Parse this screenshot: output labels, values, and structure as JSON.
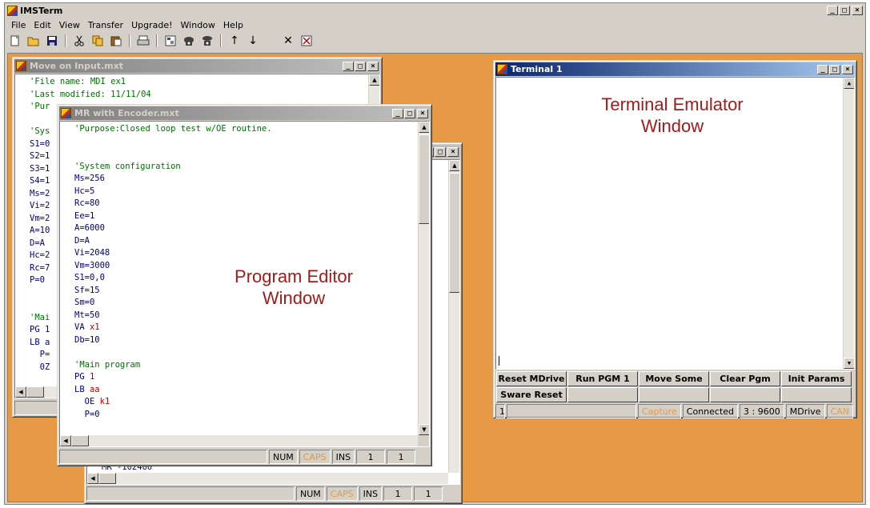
{
  "app": {
    "title": "IMSTerm"
  },
  "menu": [
    "File",
    "Edit",
    "View",
    "Transfer",
    "Upgrade!",
    "Window",
    "Help"
  ],
  "toolbar_icons": [
    "new-file-icon",
    "open-folder-icon",
    "save-icon",
    "cut-icon",
    "copy-icon",
    "paste-icon",
    "print-icon",
    "properties-icon",
    "connect-icon",
    "disconnect-icon",
    "upload-icon",
    "download-icon",
    "close-x-icon",
    "stop-box-icon"
  ],
  "windows": {
    "move_on_input": {
      "title": "Move on Input.mxt",
      "lines": [
        "'File name: MDI ex1",
        "'Last modified: 11/11/04",
        "'Pur",
        "",
        "'Sys",
        "S1=0",
        "S2=1",
        "S3=1",
        "S4=1",
        "Ms=2",
        "Vi=2",
        "Vm=2",
        "A=10",
        "D=A",
        "Hc=2",
        "Rc=7",
        "P=0",
        "",
        "",
        "'Mai",
        "PG 1",
        "LB a",
        "  P=",
        "  0Z"
      ]
    },
    "third_editor": {
      "lines": [
        "MR -102400"
      ],
      "status": {
        "num": "NUM",
        "caps": "CAPS",
        "ins": "INS",
        "line": "1",
        "col": "1"
      }
    },
    "mr_encoder": {
      "title": "MR with Encoder.mxt",
      "lines": [
        {
          "t": "'Purpose:Closed loop test w/OE routine.",
          "c": "com"
        },
        {
          "t": "",
          "c": ""
        },
        {
          "t": "",
          "c": ""
        },
        {
          "t": "'System configuration",
          "c": "com"
        },
        {
          "t": "Ms=256",
          "c": "kw"
        },
        {
          "t": "Hc=5",
          "c": "kw"
        },
        {
          "t": "Rc=80",
          "c": "kw"
        },
        {
          "t": "Ee=1",
          "c": "kw"
        },
        {
          "t": "A=6000",
          "c": "kw"
        },
        {
          "t": "D=A",
          "c": "kw"
        },
        {
          "t": "Vi=2048",
          "c": "kw"
        },
        {
          "t": "Vm=3000",
          "c": "kw"
        },
        {
          "t": "S1=0,0",
          "c": "kw"
        },
        {
          "t": "Sf=15",
          "c": "kw"
        },
        {
          "t": "Sm=0",
          "c": "kw"
        },
        {
          "t": "Mt=50",
          "c": "kw"
        },
        {
          "t": "VA x1",
          "c": "va"
        },
        {
          "t": "Db=10",
          "c": "kw"
        },
        {
          "t": "",
          "c": ""
        },
        {
          "t": "'Main program",
          "c": "com"
        },
        {
          "t": "PG 1",
          "c": "pg"
        },
        {
          "t": "LB aa",
          "c": "lb"
        },
        {
          "t": "  OE k1",
          "c": "oe"
        },
        {
          "t": "  P=0",
          "c": "kw"
        }
      ],
      "status": {
        "num": "NUM",
        "caps": "CAPS",
        "ins": "INS",
        "line": "1",
        "col": "1"
      },
      "overlay_line1": "Program Editor",
      "overlay_line2": "Window"
    },
    "terminal": {
      "title": "Terminal 1",
      "overlay_line1": "Terminal Emulator",
      "overlay_line2": "Window",
      "buttons_row1": [
        "Reset MDrive",
        "Run PGM 1",
        "Move Some",
        "Clear Pgm",
        "Init Params"
      ],
      "buttons_row2": [
        "Sware Reset",
        "",
        "",
        "",
        ""
      ],
      "status": {
        "line": "1",
        "capture": "Capture",
        "connected": "Connected",
        "baud": "3 : 9600",
        "device": "MDrive",
        "can": "CAN"
      }
    }
  }
}
